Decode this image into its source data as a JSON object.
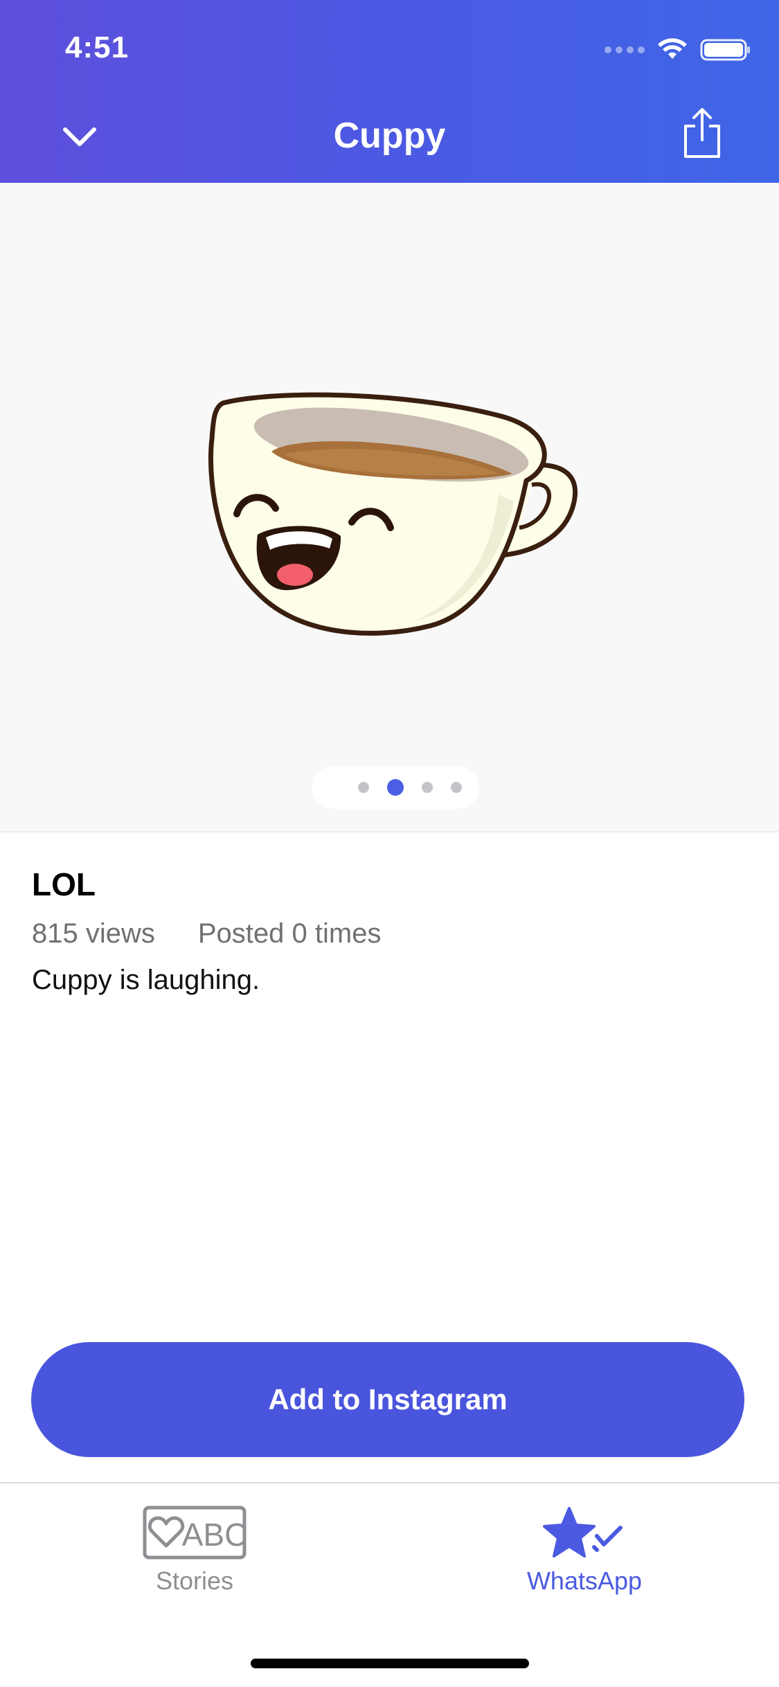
{
  "status_bar": {
    "time": "4:51"
  },
  "nav": {
    "title": "Cuppy",
    "back_icon": "chevron-down-icon",
    "share_icon": "share-icon"
  },
  "preview": {
    "sticker_name": "Cuppy laughing cup",
    "pager": {
      "count": 4,
      "active_index": 1
    }
  },
  "sticker": {
    "title": "LOL",
    "views": "815 views",
    "posted": "Posted 0 times",
    "description": "Cuppy is laughing."
  },
  "cta": {
    "label": "Add to Instagram"
  },
  "tabbar": {
    "items": [
      {
        "label": "Stories",
        "icon": "stories-abc-icon",
        "active": false
      },
      {
        "label": "WhatsApp",
        "icon": "star-check-icon",
        "active": true
      }
    ]
  },
  "colors": {
    "accent": "#4a55dd",
    "header_gradient_start": "#5e4fdc",
    "header_gradient_end": "#3f66e6",
    "tab_active": "#4b5ae0",
    "tab_inactive": "#8e8e93"
  }
}
